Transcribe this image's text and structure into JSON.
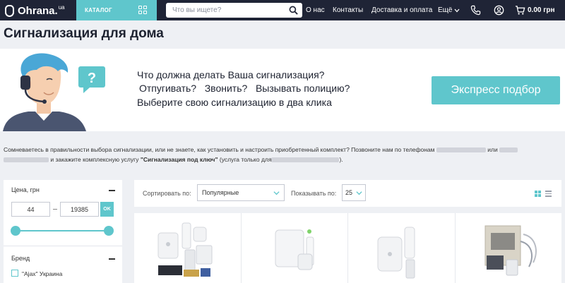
{
  "header": {
    "logo_text": "Ohrana.",
    "logo_suffix": "ua",
    "catalog_label": "КАТАЛОГ",
    "search_placeholder": "Что вы ищете?",
    "nav": [
      "О нас",
      "Контакты",
      "Доставка и оплата",
      "Ещё"
    ],
    "cart_total": "0.00 грн"
  },
  "page_title": "Сигнализация для дома",
  "banner": {
    "lines": [
      "Что должна делать Ваша сигнализация?",
      "Отпугивать?   Звонить?   Вызывать полицию?",
      "Выберите свою сигнализацию в два клика"
    ],
    "button_label": "Экспресс подбор",
    "bubble_glyph": "?"
  },
  "info": {
    "part1": "Сомневаетесь в правильности выбора сигнализации, или не знаете, как установить и настроить приобретенный комплект? Позвоните нам по телефонам",
    "part2": "или",
    "part3": "и закажите комплексную услугу",
    "service": "\"Сигнализация под ключ\"",
    "part4": "(услуга только для",
    "part5": ")."
  },
  "filters": {
    "price_title": "Цена, грн",
    "price_min": "44",
    "price_max": "19385",
    "ok_label": "OK",
    "brand_title": "Бренд",
    "brand_option": "\"Ajax\" Украина"
  },
  "sort": {
    "sort_label": "Сортировать по:",
    "sort_value": "Популярные",
    "show_label": "Показывать по:",
    "show_value": "25"
  },
  "colors": {
    "accent": "#5fc6cc",
    "header_bg": "#1f2436",
    "page_bg": "#eef0f4"
  },
  "products": [
    {
      "icon": "alarm-kit-image"
    },
    {
      "icon": "alarm-kit-image"
    },
    {
      "icon": "alarm-kit-image"
    },
    {
      "icon": "alarm-box-image"
    }
  ]
}
